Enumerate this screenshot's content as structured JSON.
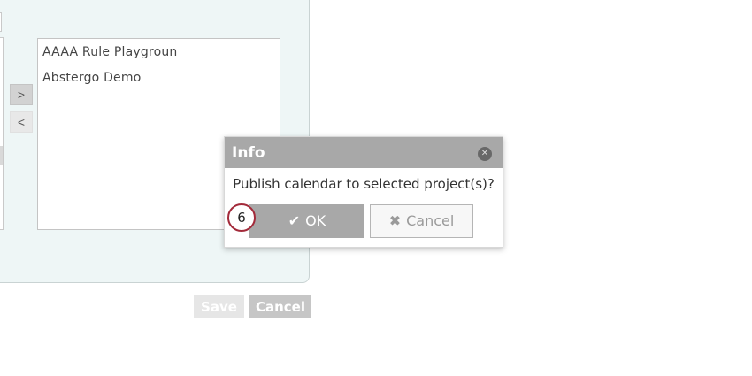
{
  "panel": {
    "selected_projects": [
      {
        "label": "AAAA Rule Playgroun"
      },
      {
        "label": "Abstergo Demo"
      }
    ],
    "move_right_label": ">",
    "move_left_label": "<"
  },
  "footer": {
    "save_label": "Save",
    "cancel_label": "Cancel"
  },
  "dialog": {
    "title": "Info",
    "close_glyph": "✕",
    "message": "Publish calendar to selected project(s)?",
    "ok_icon": "✔",
    "ok_label": "OK",
    "cancel_icon": "✖",
    "cancel_label": "Cancel"
  },
  "annotation": {
    "step_number": "6"
  },
  "colors": {
    "panel_bg": "#eef6f6",
    "dialog_header": "#a8a8a8",
    "badge_border": "#a32a3a"
  }
}
